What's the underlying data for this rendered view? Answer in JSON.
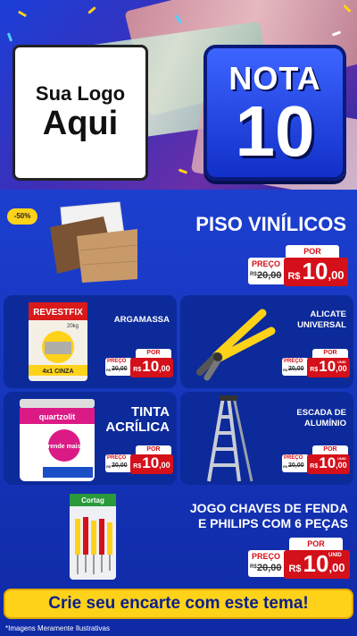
{
  "header": {
    "logo_line1": "Sua Logo",
    "logo_line2": "Aqui",
    "title_line1": "NOTA",
    "title_line2": "10"
  },
  "featured": {
    "badge": "-50%",
    "name": "PISO VINÍLICOS",
    "por_label": "POR",
    "preco_label": "PREÇO",
    "old_price_prefix": "R$",
    "old_price": "20,00",
    "currency": "R$",
    "price_int": "10",
    "price_dec": ",00"
  },
  "products": [
    {
      "name": "ARGAMASSA",
      "por_label": "POR",
      "preco_label": "PREÇO",
      "old_price_prefix": "R$",
      "old_price": "20,00",
      "currency": "R$",
      "price_int": "10",
      "price_dec": ",00",
      "unit": ""
    },
    {
      "name": "ALICATE UNIVERSAL",
      "por_label": "POR",
      "preco_label": "PREÇO",
      "old_price_prefix": "R$",
      "old_price": "20,00",
      "currency": "R$",
      "price_int": "10",
      "price_dec": ",00",
      "unit": "UNID"
    },
    {
      "name": "TINTA ACRÍLICA",
      "por_label": "POR",
      "preco_label": "PREÇO",
      "old_price_prefix": "R$",
      "old_price": "20,00",
      "currency": "R$",
      "price_int": "10",
      "price_dec": ",00",
      "unit": ""
    },
    {
      "name": "ESCADA DE ALUMÍNIO",
      "por_label": "POR",
      "preco_label": "PREÇO",
      "old_price_prefix": "R$",
      "old_price": "20,00",
      "currency": "R$",
      "price_int": "10",
      "price_dec": ",00",
      "unit": "UNID"
    }
  ],
  "bottom_product": {
    "name_line1": "JOGO CHAVES DE FENDA",
    "name_line2": "E PHILIPS COM 6 PEÇAS",
    "por_label": "POR",
    "preco_label": "PREÇO",
    "old_price_prefix": "R$",
    "old_price": "20,00",
    "currency": "R$",
    "price_int": "10",
    "price_dec": ",00",
    "unit": "UNID"
  },
  "product_labels": {
    "argamassa_brand": "REVESTFIX",
    "argamassa_weight": "20kg",
    "argamassa_type": "4x1 CINZA",
    "tinta_brand": "quartzolit",
    "tinta_badge": "rende mais",
    "chaves_brand": "Cortag"
  },
  "cta": "Crie seu encarte com este tema!",
  "disclaimer": "*Imagens Meramente Ilustrativas",
  "colors": {
    "brand_blue": "#1c3fcf",
    "card_blue": "#0c2a9a",
    "price_red": "#d4101a",
    "banner_yellow": "#ffd21a"
  }
}
